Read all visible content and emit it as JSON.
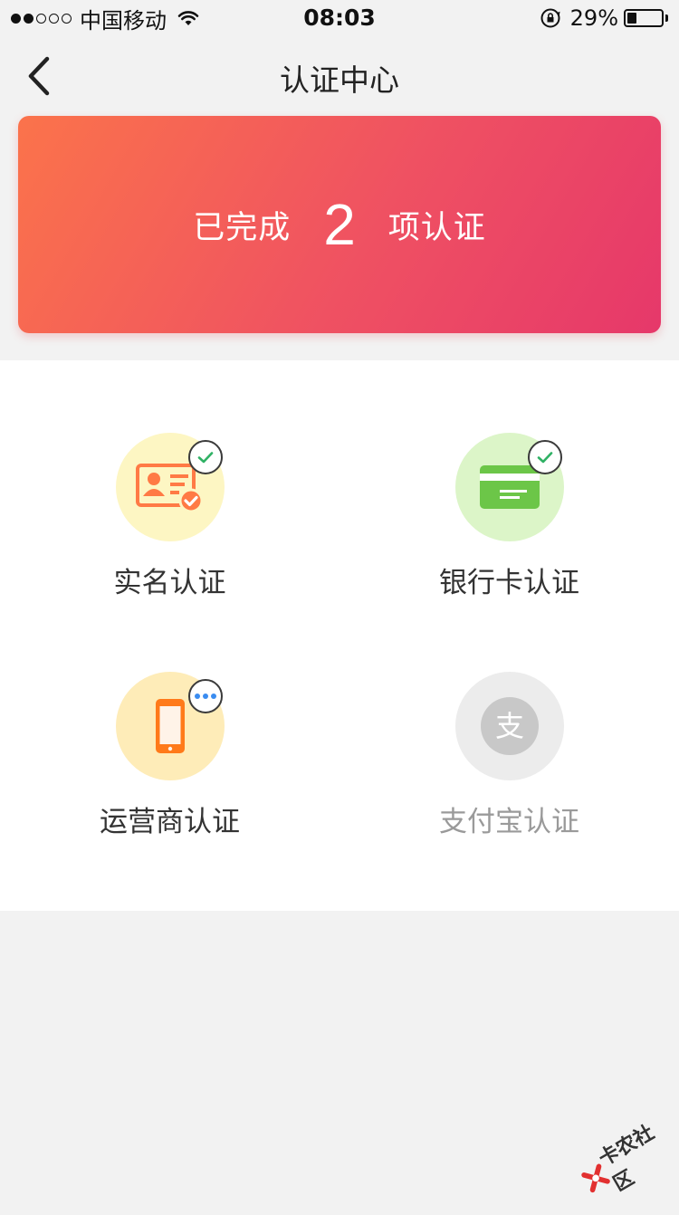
{
  "status_bar": {
    "carrier": "中国移动",
    "time": "08:03",
    "battery": "29%",
    "battery_level": 0.29
  },
  "nav": {
    "title": "认证中心",
    "back_icon": "chevron-left-icon"
  },
  "summary": {
    "prefix": "已完成",
    "count": "2",
    "suffix": "项认证",
    "gradient_start": "#fb734b",
    "gradient_end": "#e6386a"
  },
  "auth_items": [
    {
      "label": "实名认证",
      "status": "completed",
      "icon": "id-card-icon",
      "bg": "#fdf6c3",
      "icon_color": "#ff7a45"
    },
    {
      "label": "银行卡认证",
      "status": "completed",
      "icon": "bank-card-icon",
      "bg": "#dcf5c8",
      "icon_color": "#6cc648"
    },
    {
      "label": "运营商认证",
      "status": "in-progress",
      "icon": "phone-icon",
      "bg": "#feecb8",
      "icon_color": "#ff7a1a"
    },
    {
      "label": "支付宝认证",
      "status": "disabled",
      "icon": "alipay-icon",
      "bg": "#ececec",
      "icon_color": "#c8c8c8",
      "glyph": "支"
    }
  ],
  "colors": {
    "check": "#2fb164",
    "dots": "#3a8cf0"
  },
  "watermark": {
    "text": "卡农社区"
  }
}
